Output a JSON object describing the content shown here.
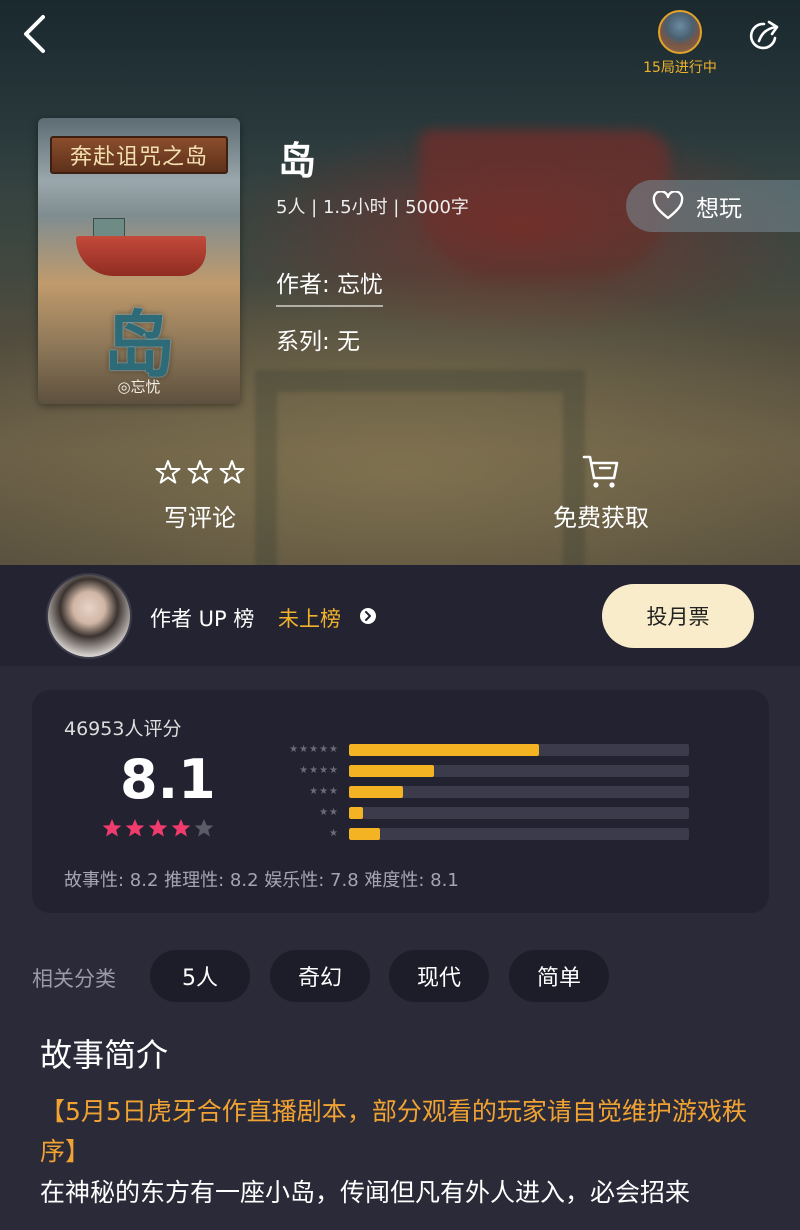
{
  "header": {
    "back_icon": "chevron-left-icon",
    "in_progress": "15局进行中",
    "share_icon": "share-icon"
  },
  "cover": {
    "plank_text": "奔赴诅咒之岛",
    "glyph": "岛",
    "signature": "◎忘忧"
  },
  "book": {
    "title": "岛",
    "meta": "5人 | 1.5小时 | 5000字",
    "author": "作者: 忘忧",
    "series": "系列: 无",
    "want_label": "想玩"
  },
  "actions": {
    "review_label": "写评论",
    "get_label": "免费获取"
  },
  "author_bar": {
    "up_label": "作者 UP 榜",
    "rank_text": "未上榜",
    "vote_label": "投月票"
  },
  "rating": {
    "count_text": "46953人评分",
    "score": "8.1",
    "stars_filled": 4,
    "stars_total": 5,
    "distribution": [
      {
        "stars": 5,
        "fraction": 0.56
      },
      {
        "stars": 4,
        "fraction": 0.25
      },
      {
        "stars": 3,
        "fraction": 0.16
      },
      {
        "stars": 2,
        "fraction": 0.04
      },
      {
        "stars": 1,
        "fraction": 0.09
      }
    ],
    "dims_text": "故事性: 8.2   推理性: 8.2   娱乐性: 7.8   难度性: 8.1",
    "colors": {
      "accent": "#f4b322",
      "star": "#f03c6c"
    }
  },
  "tags": {
    "label": "相关分类",
    "items": [
      "5人",
      "奇幻",
      "现代",
      "简单"
    ]
  },
  "story": {
    "title": "故事简介",
    "notice": "【5月5日虎牙合作直播剧本，部分观看的玩家请自觉维护游戏秩序】",
    "body": "在神秘的东方有一座小岛，传闻但凡有外人进入，必会招来"
  }
}
